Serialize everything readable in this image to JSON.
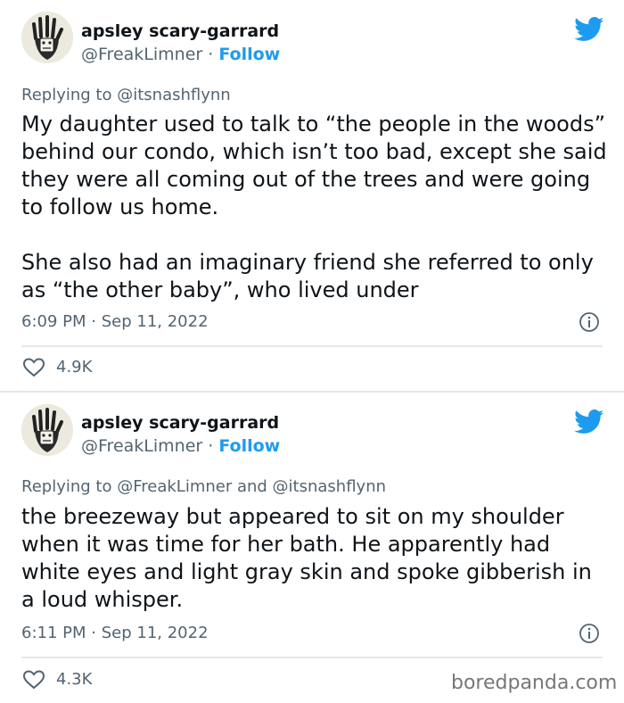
{
  "brand": {
    "twitter_blue": "#1d9bf0",
    "muted_text": "#536471"
  },
  "tweets": [
    {
      "display_name": "apsley scary-garrard",
      "handle": "@FreakLimner",
      "separator": "·",
      "follow_label": "Follow",
      "replying_prefix": "Replying to",
      "replying_to": "@itsnashflynn",
      "text": "My daughter used to talk to “the people in the woods” behind our condo, which isn’t too bad, except she said they were all coming out of the trees and were going to follow us home.\n\nShe also had an imaginary friend she referred to only as “the other baby”, who lived under",
      "time": "6:09 PM",
      "date": "Sep 11, 2022",
      "likes": "4.9K",
      "icons": [
        "avatar-hand-drawing",
        "twitter-bird-icon",
        "info-icon",
        "heart-icon"
      ]
    },
    {
      "display_name": "apsley scary-garrard",
      "handle": "@FreakLimner",
      "separator": "·",
      "follow_label": "Follow",
      "replying_prefix": "Replying to",
      "replying_to": "@FreakLimner and @itsnashflynn",
      "text": "the breezeway but appeared to sit on my shoulder when it was time for her bath. He apparently had white eyes and light gray skin and spoke gibberish in a loud whisper.",
      "time": "6:11 PM",
      "date": "Sep 11, 2022",
      "likes": "4.3K",
      "icons": [
        "avatar-hand-drawing",
        "twitter-bird-icon",
        "info-icon",
        "heart-icon"
      ]
    }
  ],
  "watermark": "boredpanda.com"
}
